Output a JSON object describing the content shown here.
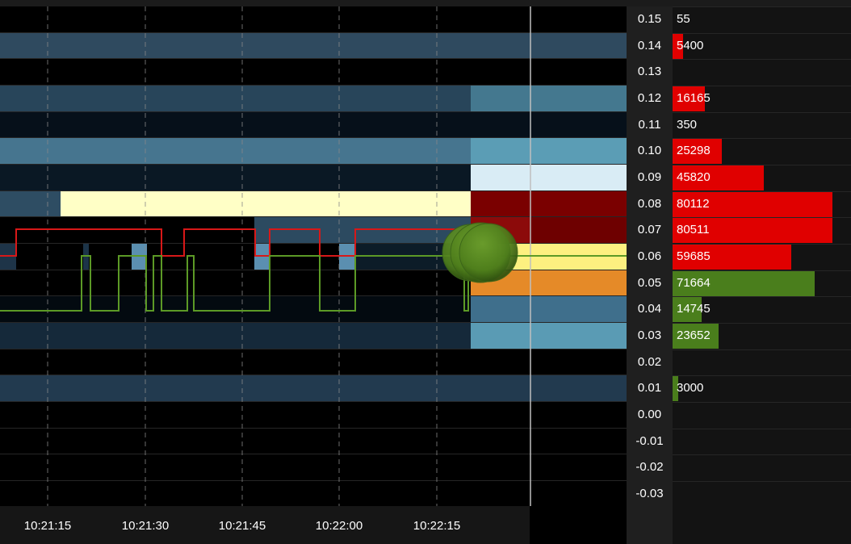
{
  "time_axis": {
    "ticks": [
      "10:21:15",
      "10:21:30",
      "10:21:45",
      "10:22:00",
      "10:22:15"
    ]
  },
  "price_ladder": [
    {
      "price": "0.15",
      "volume": "55",
      "side": "none",
      "pct": 0.0
    },
    {
      "price": "0.14",
      "volume": "5400",
      "side": "ask",
      "pct": 0.067
    },
    {
      "price": "0.13",
      "volume": "",
      "side": "none",
      "pct": 0.0
    },
    {
      "price": "0.12",
      "volume": "16165",
      "side": "ask",
      "pct": 0.2
    },
    {
      "price": "0.11",
      "volume": "350",
      "side": "none",
      "pct": 0.0
    },
    {
      "price": "0.10",
      "volume": "25298",
      "side": "ask",
      "pct": 0.31
    },
    {
      "price": "0.09",
      "volume": "45820",
      "side": "ask",
      "pct": 0.57
    },
    {
      "price": "0.08",
      "volume": "80112",
      "side": "ask",
      "pct": 1.0
    },
    {
      "price": "0.07",
      "volume": "80511",
      "side": "ask",
      "pct": 1.0
    },
    {
      "price": "0.06",
      "volume": "59685",
      "side": "ask",
      "pct": 0.74
    },
    {
      "price": "0.05",
      "volume": "71664",
      "side": "bid",
      "pct": 0.89
    },
    {
      "price": "0.04",
      "volume": "14745",
      "side": "bid",
      "pct": 0.18
    },
    {
      "price": "0.03",
      "volume": "23652",
      "side": "bid",
      "pct": 0.29
    },
    {
      "price": "0.02",
      "volume": "",
      "side": "none",
      "pct": 0.0
    },
    {
      "price": "0.01",
      "volume": "3000",
      "side": "bid",
      "pct": 0.035
    },
    {
      "price": "0.00",
      "volume": "",
      "side": "none",
      "pct": 0.0
    },
    {
      "price": "-0.01",
      "volume": "",
      "side": "none",
      "pct": 0.0
    },
    {
      "price": "-0.02",
      "volume": "",
      "side": "none",
      "pct": 0.0
    },
    {
      "price": "-0.03",
      "volume": "",
      "side": "none",
      "pct": 0.0
    }
  ],
  "colors": {
    "ask_bar": "#e00000",
    "bid_bar": "#4a7e1c",
    "best_bid_line": "#d81818",
    "best_ask_line": "#5c9a26",
    "trade_bubble": "#4f7f1c",
    "grid": "#888888",
    "now_line": "#bfbfbf"
  }
}
